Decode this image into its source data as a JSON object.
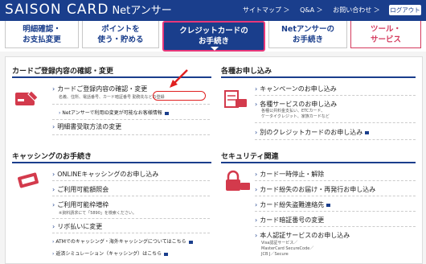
{
  "header": {
    "logo": "SAISON CARD",
    "logo_sub": "Netアンサー",
    "links": [
      "サイトマップ ＞",
      "Q&A ＞",
      "お問い合わせ ＞"
    ],
    "logout": "ログアウト"
  },
  "tabs": [
    {
      "label": "明細確認・\nお支払変更"
    },
    {
      "label": "ポイントを\n使う・貯める"
    },
    {
      "label": "クレジットカードの\nお手続き"
    },
    {
      "label": "Netアンサーの\nお手続き"
    },
    {
      "label": "ツール・\nサービス"
    }
  ],
  "sections": {
    "card_info": {
      "title": "カードご登録内容の確認・変更",
      "items": [
        {
          "label": "カードご登録内容の確認・変更",
          "note": "名義、住所、電話番号、カード暗証番号 勤務先などの登録"
        },
        {
          "label": "Netアンサーで利用ID変更が可能なお客様情報",
          "small": true
        },
        {
          "label": "明細書受取方法の変更"
        }
      ]
    },
    "apply": {
      "title": "各種お申し込み",
      "items": [
        {
          "label": "キャンペーンのお申し込み"
        },
        {
          "label": "各種サービスのお申し込み",
          "note": "各種公共料金支払い、ETCカード、\nケータイクレジット、家族カードなど"
        },
        {
          "label": "別のクレジットカードのお申し込み"
        }
      ]
    },
    "cashing": {
      "title": "キャッシングのお手続き",
      "items": [
        {
          "label": "ONLINEキャッシングのお申し込み"
        },
        {
          "label": "ご利用可能額照会"
        },
        {
          "label": "ご利用可能枠増枠",
          "note": "※資料請求にて「5890」を検索ください。"
        },
        {
          "label": "リボ払いに変更"
        },
        {
          "label": "ATMでのキャッシング・海外キャッシングについてはこちら",
          "small": true
        },
        {
          "label": "返済シミュレーション（キャッシング）はこちら",
          "small": true
        }
      ]
    },
    "security": {
      "title": "セキュリティ関連",
      "items": [
        {
          "label": "カード一時停止・解除"
        },
        {
          "label": "カード紛失のお届け・再発行お申し込み"
        },
        {
          "label": "カード紛失盗難連絡先"
        },
        {
          "label": "カード暗証番号の変更"
        },
        {
          "label": "本人認証サービスのお申し込み",
          "note": "Visa認証サービス／\nMasterCard SecureCode／\nJCB J／Secure"
        }
      ]
    }
  },
  "colors": {
    "brand": "#1a3e8c",
    "accent": "#e8387a",
    "red": "#d43b5e",
    "icon": "#d33a4c"
  }
}
